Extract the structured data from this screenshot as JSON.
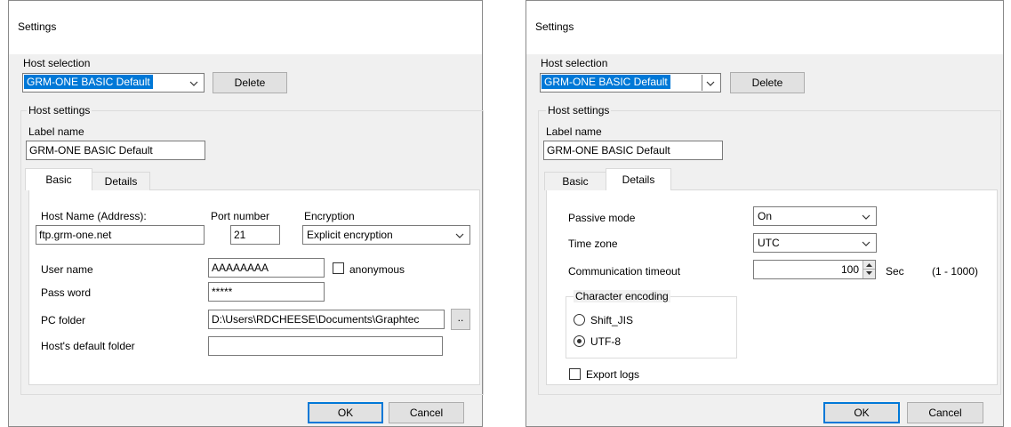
{
  "left_dialog": {
    "title": "Settings",
    "host_selection_label": "Host selection",
    "host_selection_value": "GRM-ONE BASIC Default",
    "delete_button": "Delete",
    "host_settings_label": "Host settings",
    "label_name_label": "Label name",
    "label_name_value": "GRM-ONE BASIC Default",
    "tabs": [
      {
        "label": "Basic"
      },
      {
        "label": "Details"
      }
    ],
    "active_tab": "Basic",
    "host_name_label": "Host Name (Address):",
    "host_name_value": "ftp.grm-one.net",
    "port_label": "Port number",
    "port_value": "21",
    "encryption_label": "Encryption",
    "encryption_value": "Explicit encryption",
    "user_name_label": "User name",
    "user_name_value": "AAAAAAAA",
    "anonymous_label": "anonymous",
    "anonymous_checked": false,
    "password_label": "Pass word",
    "password_value": "*****",
    "pc_folder_label": "PC folder",
    "pc_folder_value": "D:\\Users\\RDCHEESE\\Documents\\Graphtec",
    "browse_button": "..",
    "default_folder_label": "Host's default folder",
    "default_folder_value": "",
    "ok_button": "OK",
    "cancel_button": "Cancel"
  },
  "right_dialog": {
    "title": "Settings",
    "host_selection_label": "Host selection",
    "host_selection_value": "GRM-ONE BASIC Default",
    "delete_button": "Delete",
    "host_settings_label": "Host settings",
    "label_name_label": "Label name",
    "label_name_value": "GRM-ONE BASIC Default",
    "tabs": [
      {
        "label": "Basic"
      },
      {
        "label": "Details"
      }
    ],
    "active_tab": "Details",
    "passive_mode_label": "Passive mode",
    "passive_mode_value": "On",
    "time_zone_label": "Time zone",
    "time_zone_value": "UTC",
    "timeout_label": "Communication timeout",
    "timeout_value": "100",
    "timeout_unit": "Sec",
    "timeout_range": "(1 - 1000)",
    "encoding_group_label": "Character encoding",
    "encoding_options": [
      {
        "label": "Shift_JIS",
        "selected": false
      },
      {
        "label": "UTF-8",
        "selected": true
      }
    ],
    "export_logs_label": "Export logs",
    "export_logs_checked": false,
    "ok_button": "OK",
    "cancel_button": "Cancel"
  }
}
